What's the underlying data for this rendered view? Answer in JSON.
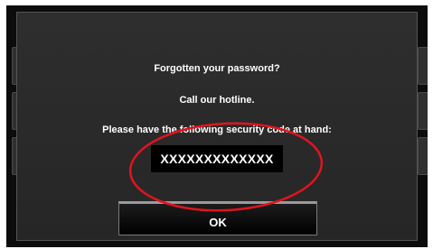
{
  "dialog": {
    "heading": "Forgotten your password?",
    "hotline_text": "Call our hotline.",
    "instruction": "Please have the following security code at hand:",
    "security_code": "XXXXXXXXXXXXX",
    "ok_label": "OK"
  },
  "colors": {
    "backdrop": "#0c0c0c",
    "dialog_background": "#2e2e2e",
    "text": "#ffffff",
    "code_box": "#000000",
    "highlight_ellipse": "#e0141e"
  }
}
